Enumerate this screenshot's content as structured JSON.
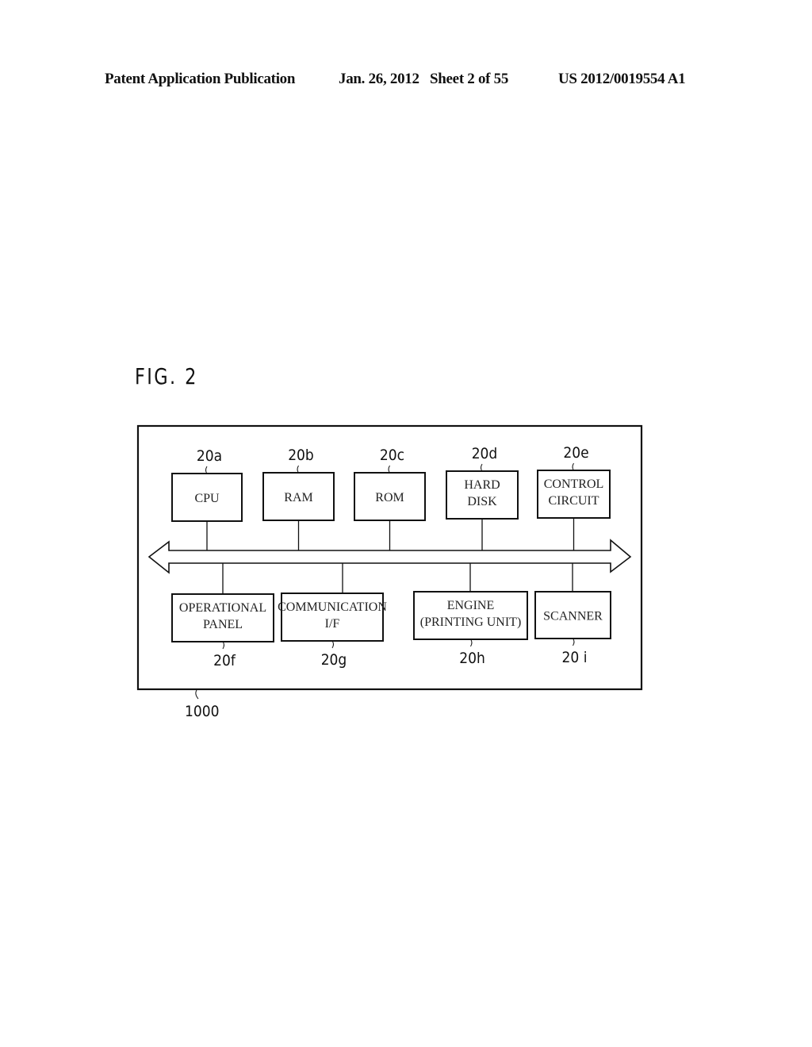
{
  "header": {
    "publication": "Patent Application Publication",
    "date_sheet": "Jan. 26, 2012   Sheet 2 of 55",
    "number": "US 2012/0019554 A1"
  },
  "figure": {
    "title": "FIG. 2",
    "outer_ref": "1000",
    "top_blocks": [
      {
        "ref": "20a",
        "lines": [
          "CPU"
        ]
      },
      {
        "ref": "20b",
        "lines": [
          "RAM"
        ]
      },
      {
        "ref": "20c",
        "lines": [
          "ROM"
        ]
      },
      {
        "ref": "20d",
        "lines": [
          "HARD",
          "DISK"
        ]
      },
      {
        "ref": "20e",
        "lines": [
          "CONTROL",
          "CIRCUIT"
        ]
      }
    ],
    "bottom_blocks": [
      {
        "ref": "20f",
        "lines": [
          "OPERATIONAL",
          "PANEL"
        ]
      },
      {
        "ref": "20g",
        "lines": [
          "COMMUNICATION",
          "I/F"
        ]
      },
      {
        "ref": "20h",
        "lines": [
          "ENGINE",
          "(PRINTING UNIT)"
        ]
      },
      {
        "ref": "20 i",
        "lines": [
          "SCANNER"
        ]
      }
    ],
    "bus": "bidirectional-bus-arrow"
  }
}
